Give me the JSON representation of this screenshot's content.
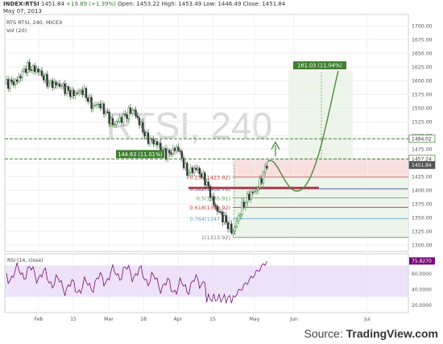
{
  "header": {
    "symbol": "INDEX:RTSI",
    "last": "1451.84",
    "change": "+19.89 (+1.39%)",
    "open_label": "Open:",
    "open": "1453.22",
    "high_label": "High:",
    "high": "1453.49",
    "low_label": "Low:",
    "low": "1446.49",
    "close_label": "Close:",
    "close": "1451.84",
    "date": "May 07, 2013",
    "series_line": "RTS RTSI, 240, MICEX",
    "vol_line": "Vol (20)",
    "watermark": "RTSI, 240"
  },
  "colors": {
    "up": "#2e7d32",
    "down": "#333333",
    "green_text": "#2e7d32",
    "target_box": "#3f7f2f",
    "rsi_band": "#e6d5f5",
    "rsi_line": "#7a0a7a"
  },
  "chart_data": {
    "type": "candlestick",
    "y_ticks": [
      "1700.00",
      "1675.00",
      "1650.00",
      "1625.00",
      "1600.00",
      "1575.00",
      "1550.00",
      "1525.00",
      "1500.00",
      "1475.00",
      "1450.00",
      "1425.00",
      "1400.00",
      "1375.00",
      "1350.00",
      "1325.00",
      "1300.00"
    ],
    "x_ticks": [
      "Feb",
      "15",
      "Mar",
      "18",
      "Apr",
      "15",
      "May",
      "Jun",
      "Jul"
    ],
    "price_labels": [
      {
        "value": 1494.02,
        "text": "1494.02"
      },
      {
        "value": 1457.24,
        "text": "1457.24"
      },
      {
        "value": 1451.84,
        "text": "1451.84"
      }
    ],
    "fib_levels": [
      {
        "label": "0.236(1423.92)",
        "value": 1423.92,
        "color": "#cc3333"
      },
      {
        "label": "0.382(1402.76)",
        "value": 1402.76,
        "color": "#4a5aa8"
      },
      {
        "label": "0.5(1385.91)",
        "value": 1385.91,
        "color": "#4c9a4c"
      },
      {
        "label": "0.618(1368.92)",
        "value": 1368.92,
        "color": "#cc3333"
      },
      {
        "label": "0.764(1347.86)",
        "value": 1347.86,
        "color": "#5a9fc9"
      },
      {
        "label": "1(1313.92)",
        "value": 1313.92,
        "color": "#777777"
      }
    ],
    "annotations": [
      {
        "text": "144.63 (11.01%)"
      },
      {
        "text": "161.03 (11.04%)"
      }
    ],
    "rsi": {
      "label": "RSI (14, close)",
      "value_text": "75.8270",
      "value": 75.827,
      "y_ticks": [
        "60.0000",
        "40.0000",
        "20.0000"
      ],
      "band": [
        30,
        70
      ]
    }
  },
  "footer": {
    "source_prefix": "Source: ",
    "source_brand": "TradingView.com"
  }
}
